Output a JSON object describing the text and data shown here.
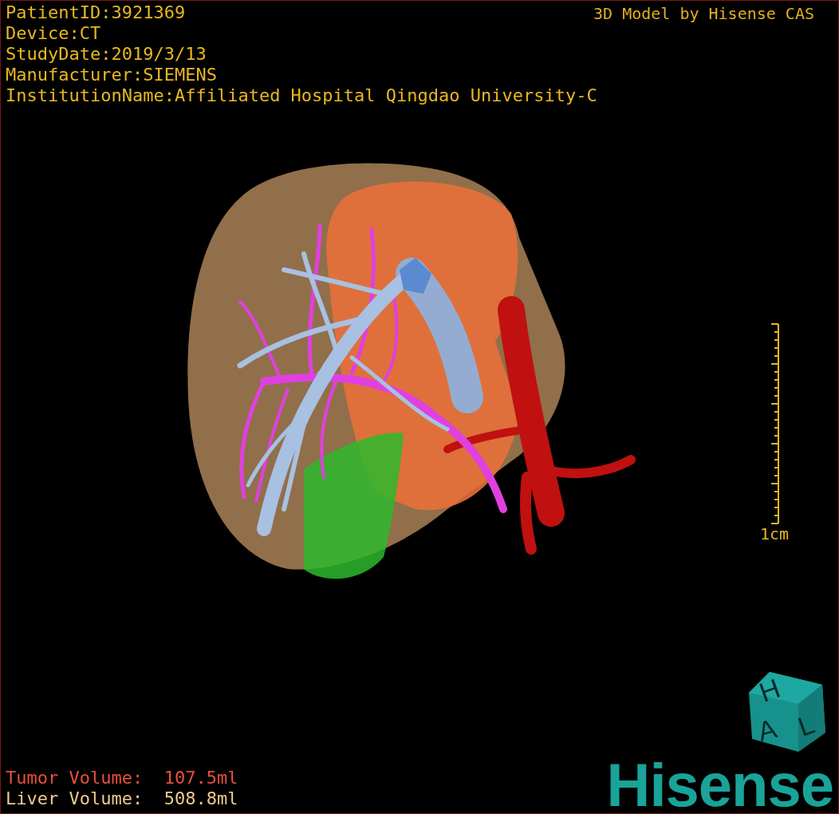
{
  "header": {
    "info": [
      "PatientID:3921369",
      "Device:CT",
      "StudyDate:2019/3/13",
      "Manufacturer:SIEMENS",
      "InstitutionName:Affiliated Hospital Qingdao University-C"
    ],
    "credit": "3D Model by Hisense CAS"
  },
  "scale_bar": {
    "label": "1cm"
  },
  "volumes": [
    {
      "kind": "tumor",
      "label": "Tumor Volume:",
      "value": "107.5ml"
    },
    {
      "kind": "liver",
      "label": "Liver Volume:",
      "value": "508.8ml"
    }
  ],
  "logo": {
    "cube_letters": [
      "H",
      "A",
      "L"
    ],
    "wordmark": "Hisense"
  }
}
